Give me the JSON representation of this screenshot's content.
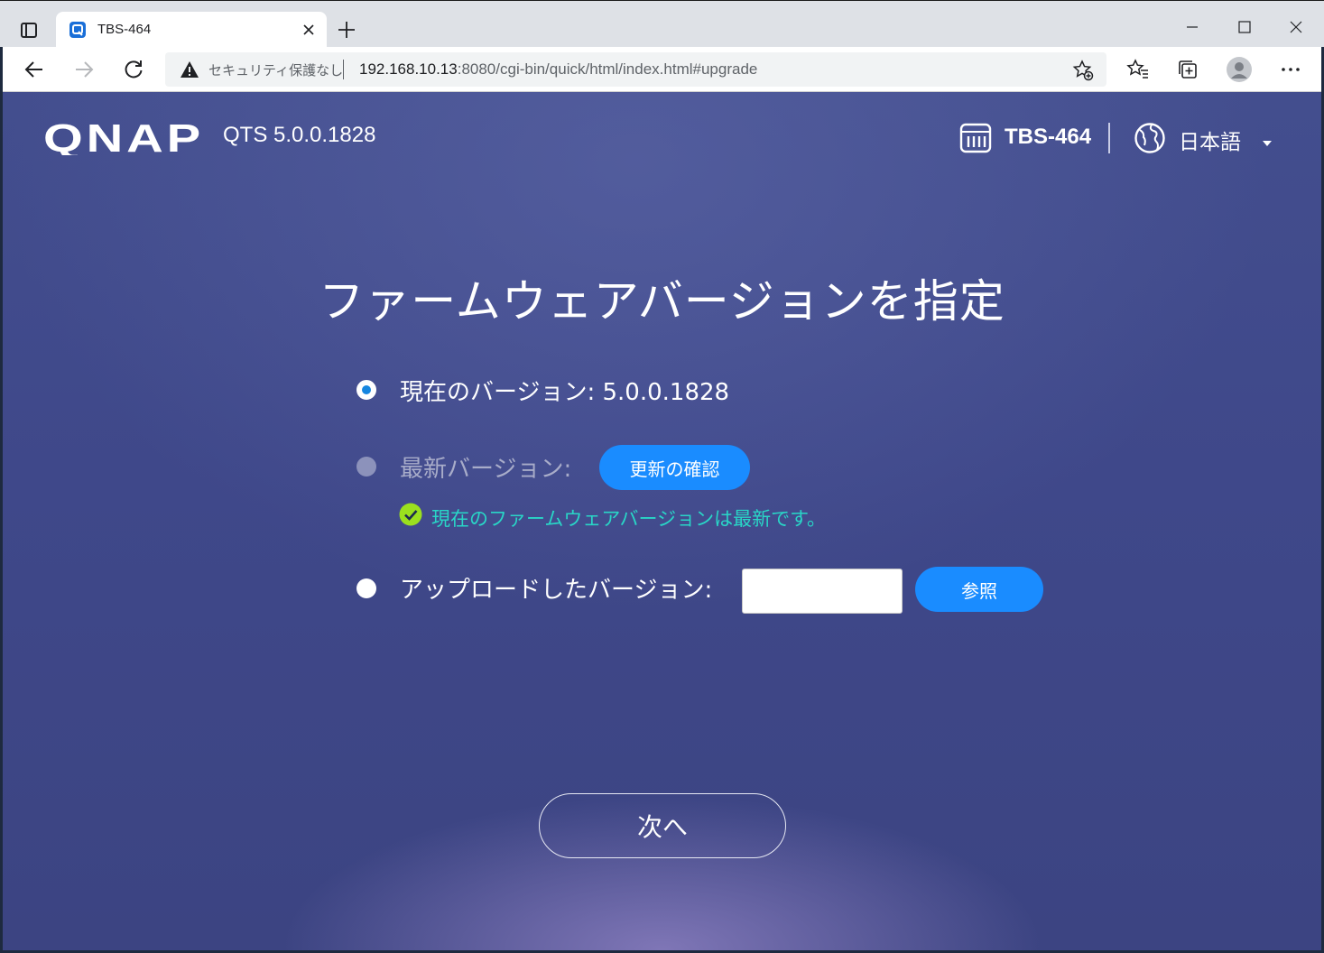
{
  "browser": {
    "tab_title": "TBS-464",
    "security_text": "セキュリティ保護なし",
    "url_host": "192.168.10.13",
    "url_rest": ":8080/cgi-bin/quick/html/index.html#upgrade"
  },
  "header": {
    "logo": "QNAP",
    "qts_version": "QTS 5.0.0.1828",
    "device_name": "TBS-464",
    "language": "日本語"
  },
  "main": {
    "title": "ファームウェアバージョンを指定",
    "options": {
      "current_label": "現在のバージョン: 5.0.0.1828",
      "latest_label": "最新バージョン:",
      "check_button": "更新の確認",
      "status_text": "現在のファームウェアバージョンは最新です。",
      "uploaded_label": "アップロードしたバージョン:",
      "file_value": "",
      "browse_button": "参照"
    },
    "next_button": "次へ"
  },
  "colors": {
    "accent": "#1a8cff",
    "success": "#29d6c7",
    "check": "#9be01e"
  }
}
